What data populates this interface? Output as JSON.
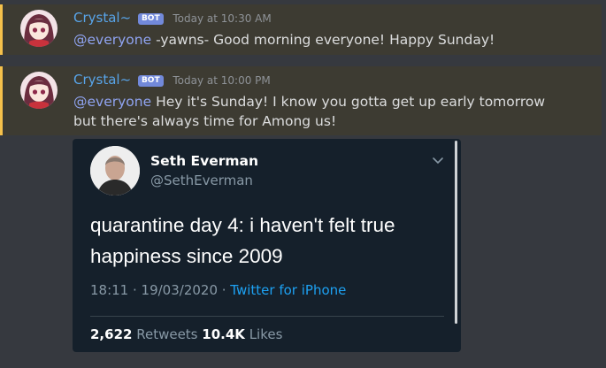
{
  "messages": [
    {
      "username": "Crystal~",
      "bot_tag": "BOT",
      "timestamp": "Today at 10:30 AM",
      "mention": "@everyone",
      "text": " -yawns- Good morning everyone! Happy Sunday!"
    },
    {
      "username": "Crystal~",
      "bot_tag": "BOT",
      "timestamp": "Today at 10:00 PM",
      "mention": "@everyone",
      "text": " Hey it's Sunday! I know you gotta get up early tomorrow but there's always time for Among us!"
    }
  ],
  "tweet": {
    "name": "Seth Everman",
    "handle": "@SethEverman",
    "text": "quarantine day 4: i haven't felt true happiness since 2009",
    "time": "18:11 · 19/03/2020 · ",
    "source": "Twitter for iPhone",
    "retweets_count": "2,622",
    "retweets_label": " Retweets ",
    "likes_count": "10.4K",
    "likes_label": " Likes"
  },
  "colors": {
    "highlight_border": "#f5c14b",
    "username": "#58a4e8",
    "mention": "#8fa3f0",
    "bot_tag": "#7289da",
    "twitter_link": "#1da1f2"
  }
}
